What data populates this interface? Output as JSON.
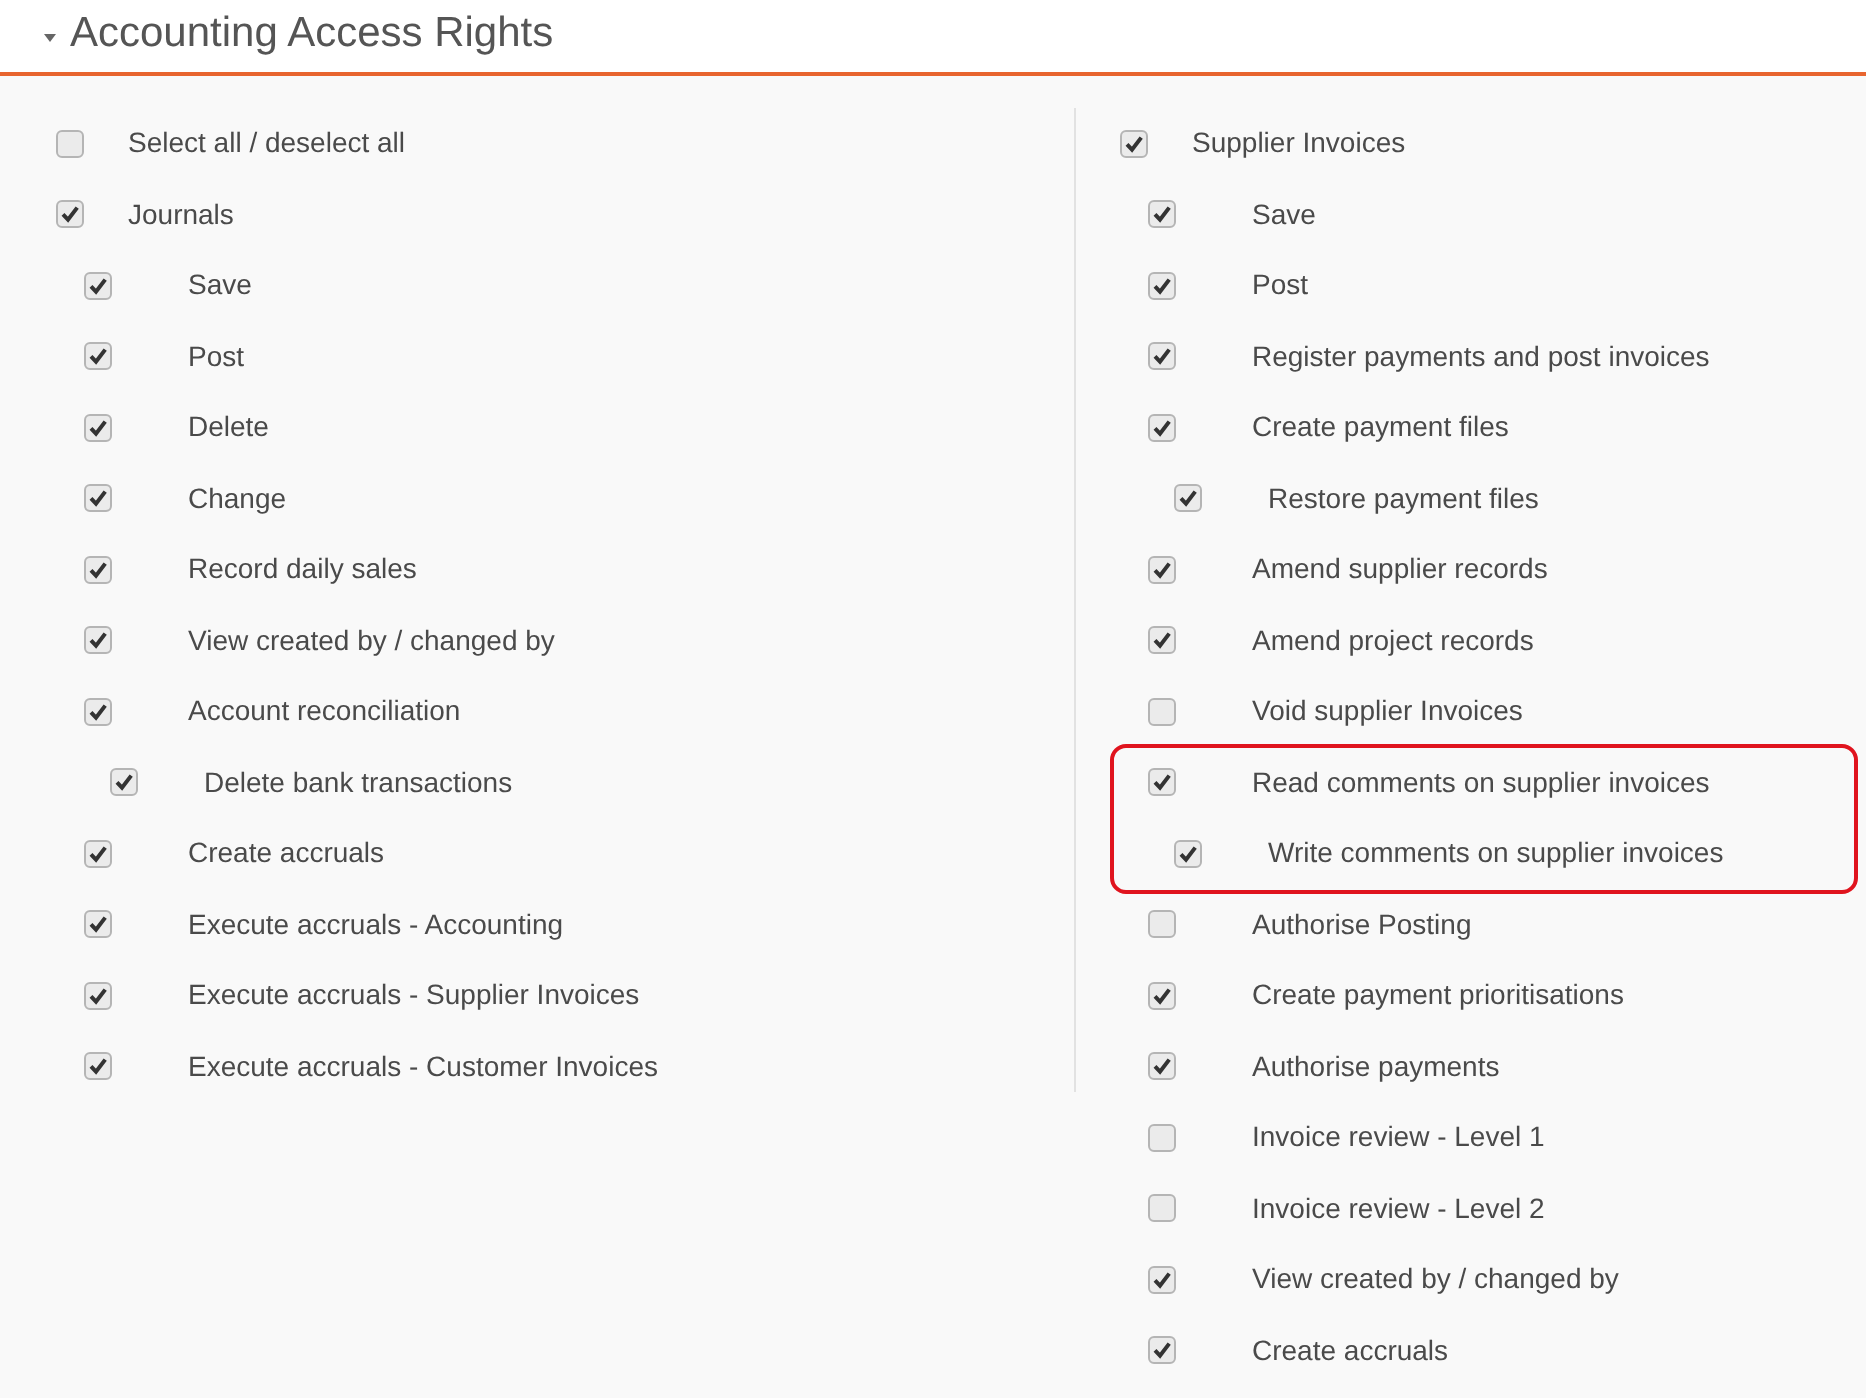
{
  "section": {
    "title": "Accounting Access Rights",
    "expanded": true
  },
  "columns": [
    {
      "items": [
        {
          "label": "Select all / deselect all",
          "checked": false
        },
        {
          "label": "Journals",
          "checked": true,
          "children": [
            {
              "label": "Save",
              "checked": true
            },
            {
              "label": "Post",
              "checked": true
            },
            {
              "label": "Delete",
              "checked": true
            },
            {
              "label": "Change",
              "checked": true
            },
            {
              "label": "Record daily sales",
              "checked": true
            },
            {
              "label": "View created by / changed by",
              "checked": true
            },
            {
              "label": "Account reconciliation",
              "checked": true,
              "children": [
                {
                  "label": "Delete bank transactions",
                  "checked": true
                }
              ]
            },
            {
              "label": "Create accruals",
              "checked": true
            },
            {
              "label": "Execute accruals - Accounting",
              "checked": true
            },
            {
              "label": "Execute accruals - Supplier Invoices",
              "checked": true
            },
            {
              "label": "Execute accruals - Customer Invoices",
              "checked": true
            }
          ]
        }
      ]
    },
    {
      "items": [
        {
          "label": "Supplier Invoices",
          "checked": true,
          "children": [
            {
              "label": "Save",
              "checked": true
            },
            {
              "label": "Post",
              "checked": true
            },
            {
              "label": "Register payments and post invoices",
              "checked": true
            },
            {
              "label": "Create payment files",
              "checked": true,
              "children": [
                {
                  "label": "Restore payment files",
                  "checked": true
                }
              ]
            },
            {
              "label": "Amend supplier records",
              "checked": true
            },
            {
              "label": "Amend project records",
              "checked": true
            },
            {
              "label": "Void supplier Invoices",
              "checked": false
            },
            {
              "label": "Read comments on supplier invoices",
              "checked": true,
              "highlighted": true,
              "children": [
                {
                  "label": "Write comments on supplier invoices",
                  "checked": true
                }
              ]
            },
            {
              "label": "Authorise Posting",
              "checked": false
            },
            {
              "label": "Create payment prioritisations",
              "checked": true
            },
            {
              "label": "Authorise payments",
              "checked": true
            },
            {
              "label": "Invoice review - Level 1",
              "checked": false
            },
            {
              "label": "Invoice review - Level 2",
              "checked": false
            },
            {
              "label": "View created by / changed by",
              "checked": true
            },
            {
              "label": "Create accruals",
              "checked": true
            }
          ]
        }
      ]
    }
  ]
}
